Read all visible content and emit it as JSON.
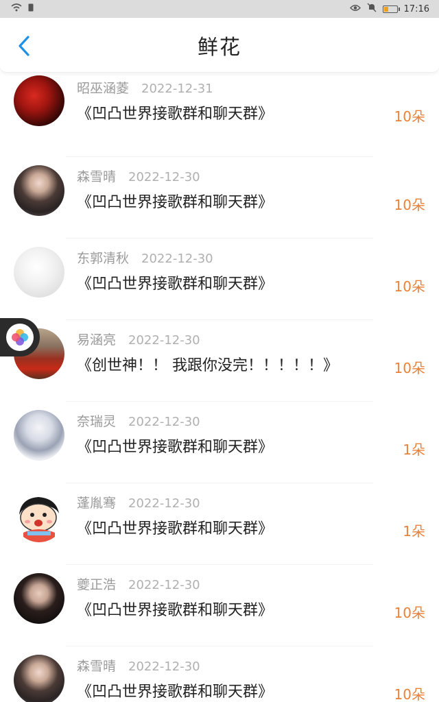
{
  "status_bar": {
    "time": "17:16"
  },
  "header": {
    "title": "鲜花"
  },
  "records": [
    {
      "user": "昭巫涵菱",
      "date": "2022-12-31",
      "song": "《凹凸世界接歌群和聊天群》",
      "count": "10朵",
      "avatar": "red-flower"
    },
    {
      "user": "森雪晴",
      "date": "2022-12-30",
      "song": "《凹凸世界接歌群和聊天群》",
      "count": "10朵",
      "avatar": "girl-dark"
    },
    {
      "user": "东郭清秋",
      "date": "2022-12-30",
      "song": "《凹凸世界接歌群和聊天群》",
      "count": "10朵",
      "avatar": "sketch"
    },
    {
      "user": "易涵亮",
      "date": "2022-12-30",
      "song": "《创世神！！ 我跟你没完！！！！！》",
      "count": "10朵",
      "avatar": "landscape"
    },
    {
      "user": "奈瑞灵",
      "date": "2022-12-30",
      "song": "《凹凸世界接歌群和聊天群》",
      "count": "1朵",
      "avatar": "anime-boy"
    },
    {
      "user": "蓬胤骞",
      "date": "2022-12-30",
      "song": "《凹凸世界接歌群和聊天群》",
      "count": "1朵",
      "avatar": "cartoon"
    },
    {
      "user": "夔正浩",
      "date": "2022-12-30",
      "song": "《凹凸世界接歌群和聊天群》",
      "count": "10朵",
      "avatar": "portrait-dark"
    },
    {
      "user": "森雪晴",
      "date": "2022-12-30",
      "song": "《凹凸世界接歌群和聊天群》",
      "count": "10朵",
      "avatar": "girl-dark"
    }
  ],
  "colors": {
    "accent": "#e8823a",
    "back": "#1e90e6"
  }
}
